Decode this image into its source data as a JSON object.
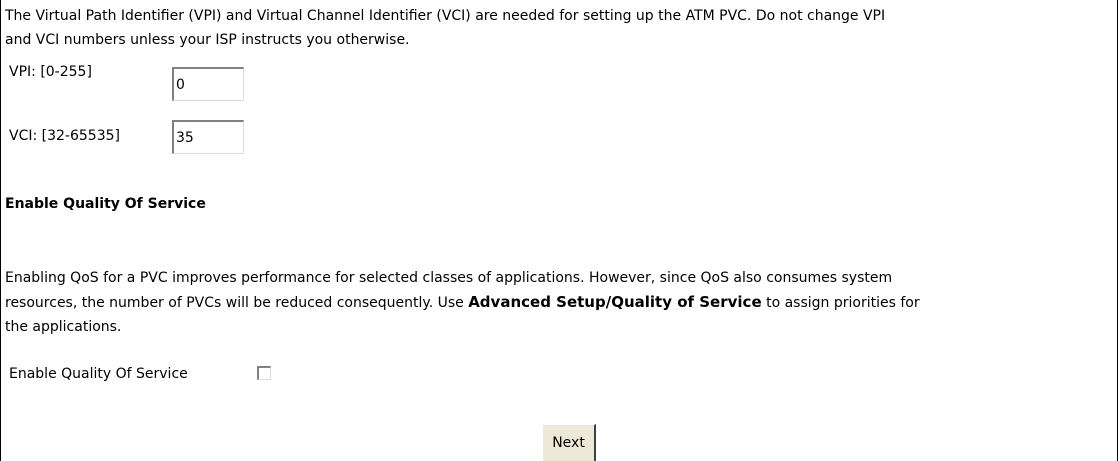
{
  "intro": {
    "line1": "The Virtual Path Identifier (VPI) and Virtual Channel Identifier (VCI) are needed for setting up the ATM PVC. Do not change VPI",
    "line2": "and VCI numbers unless your ISP instructs you otherwise."
  },
  "vpi": {
    "label": "VPI: [0-255]",
    "value": "0"
  },
  "vci": {
    "label": "VCI: [32-65535]",
    "value": "35"
  },
  "qos": {
    "heading": "Enable Quality Of Service",
    "desc_line1": "Enabling QoS for a PVC improves performance for selected classes of applications. However, since QoS also consumes system",
    "desc_line2_pre": "resources, the number of PVCs will be reduced consequently. Use ",
    "desc_line2_bold": "Advanced Setup/Quality of Service",
    "desc_line2_post": " to assign priorities for",
    "desc_line3": "the applications.",
    "checkbox_label": "Enable Quality Of Service",
    "checked": false
  },
  "actions": {
    "next_label": "Next"
  }
}
